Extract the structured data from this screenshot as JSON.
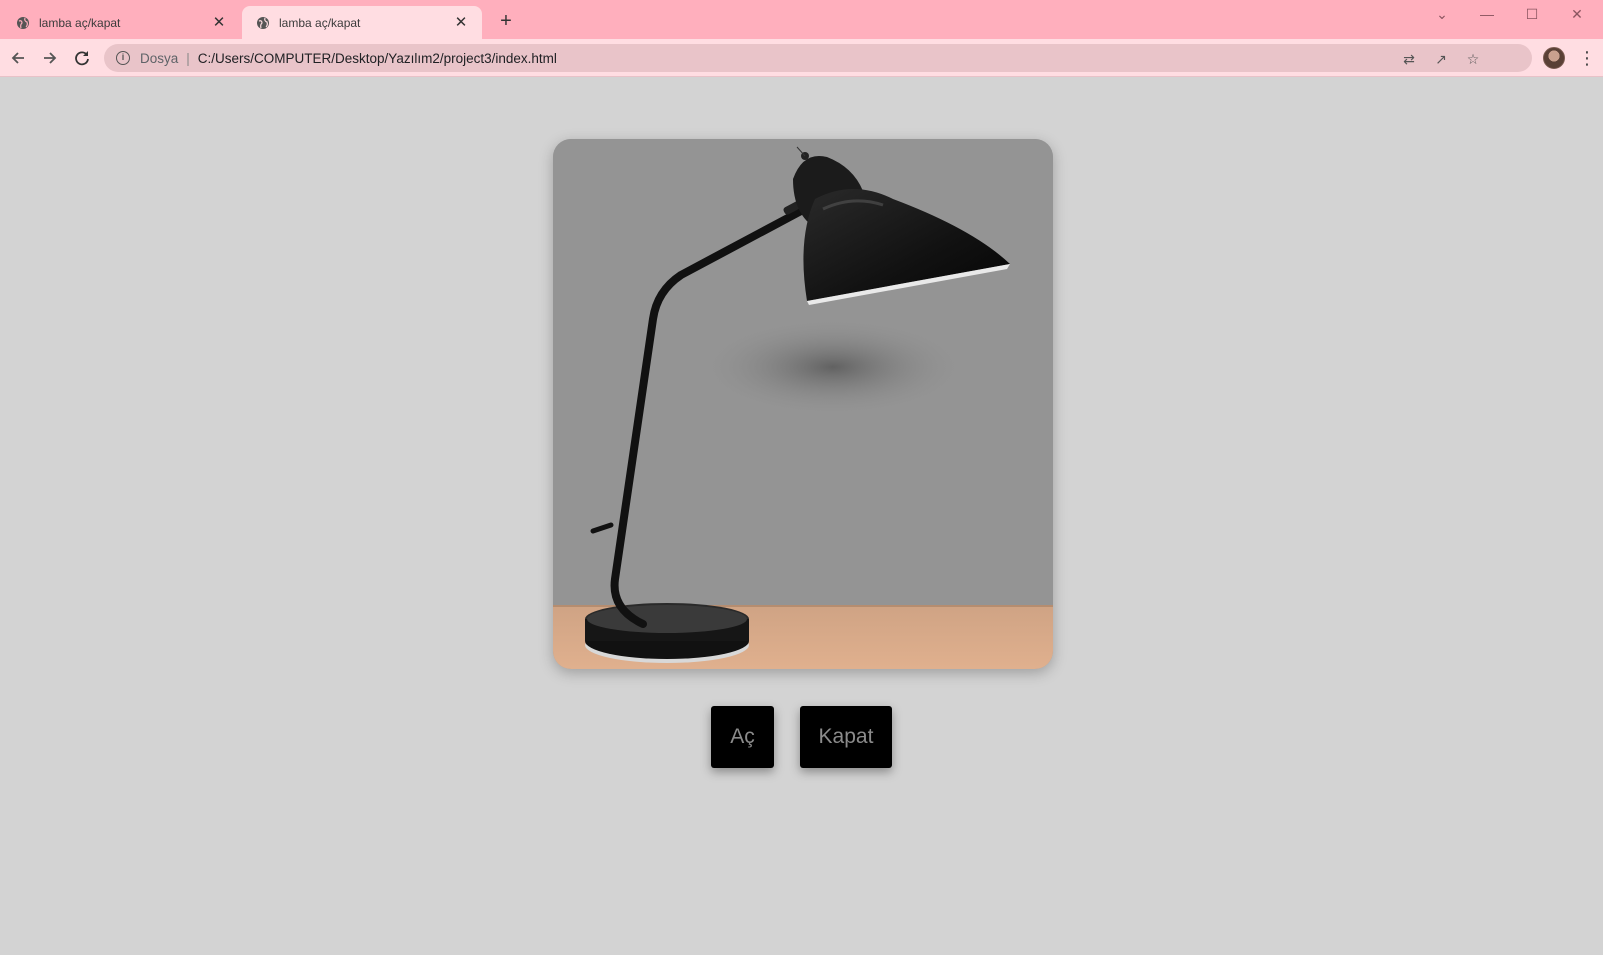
{
  "browser": {
    "tabs": [
      {
        "title": "lamba aç/kapat",
        "active": false
      },
      {
        "title": "lamba aç/kapat",
        "active": true
      }
    ],
    "address": {
      "scheme_label": "Dosya",
      "url": "C:/Users/COMPUTER/Desktop/Yazılım2/project3/index.html"
    },
    "icons": {
      "back": "arrow-left-icon",
      "forward": "arrow-right-icon",
      "reload": "reload-icon",
      "translate": "translate-icon",
      "share": "share-icon",
      "bookmark": "star-icon",
      "menu": "more-vertical-icon"
    },
    "colors": {
      "titlebar": "#ffafbd",
      "toolbar": "#ffdde2"
    }
  },
  "page": {
    "background": "#d3d3d3",
    "image_alt": "desk lamp",
    "lamp_state": "off",
    "buttons": {
      "on_label": "Aç",
      "off_label": "Kapat"
    }
  }
}
